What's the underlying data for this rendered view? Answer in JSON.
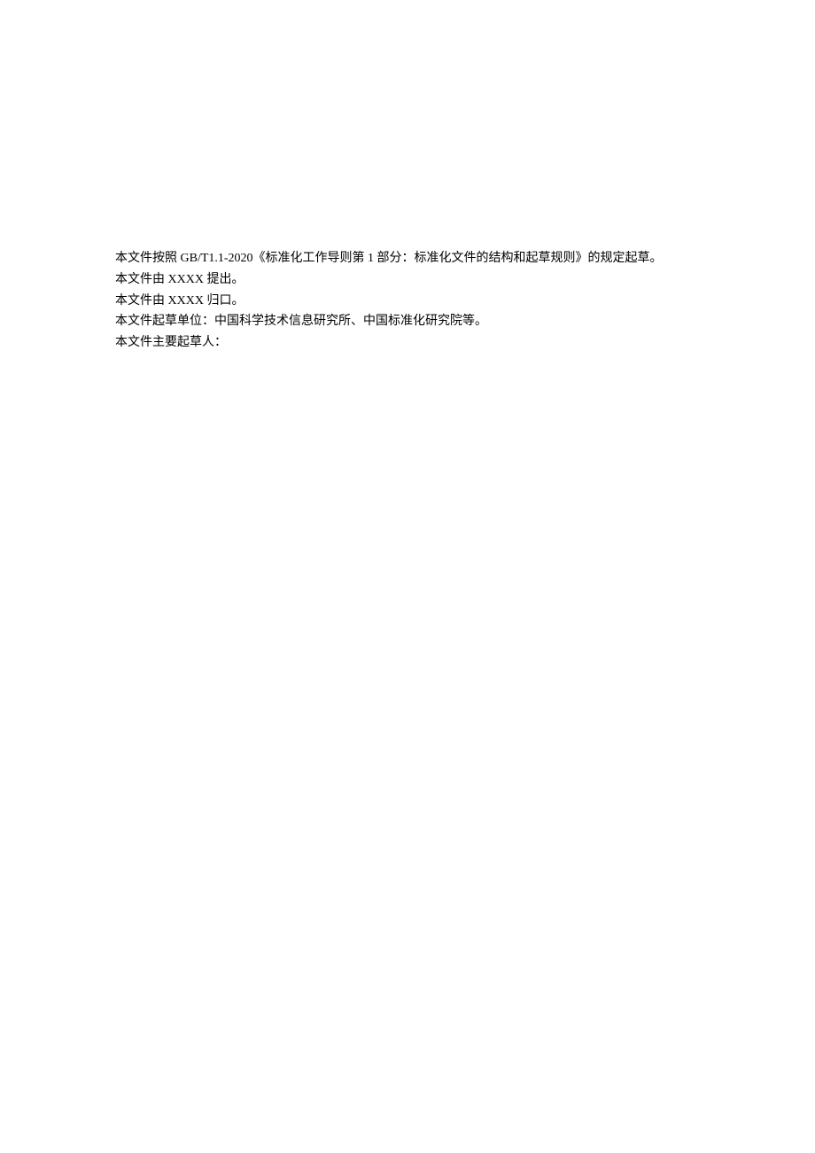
{
  "content": {
    "lines": [
      "本文件按照 GB/T1.1-2020《标准化工作导则第 1 部分：标准化文件的结构和起草规则》的规定起草。",
      "本文件由 XXXX 提出。",
      "本文件由 XXXX 归口。",
      "本文件起草单位：中国科学技术信息研究所、中国标准化研究院等。",
      "本文件主要起草人："
    ]
  }
}
